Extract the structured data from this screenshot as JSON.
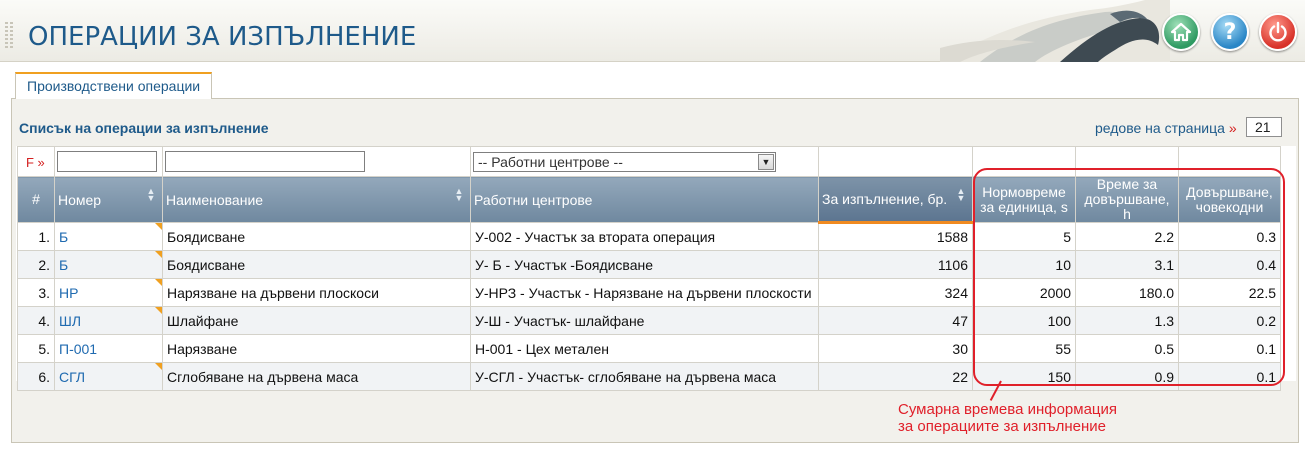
{
  "header": {
    "title": "ОПЕРАЦИИ ЗА ИЗПЪЛНЕНИЕ",
    "buttons": [
      "home-icon",
      "help-icon",
      "power-icon"
    ],
    "help_glyph": "?"
  },
  "tab": {
    "label": "Производствени операции"
  },
  "list": {
    "title": "Списък на операции за изпълнение",
    "rows_per_page_label": "редове на страница",
    "rows_per_page_marker": "»",
    "rows_per_page_value": "21"
  },
  "filter": {
    "label": "F »",
    "work_center_placeholder": "-- Работни центрове --"
  },
  "columns": [
    "#",
    "Номер",
    "Наименование",
    "Работни центрове",
    "За изпълнение, бр.",
    "Нормовреме за единица, s",
    "Време за довършване, h",
    "Довършване, човекодни"
  ],
  "columns_split": {
    "c6a": "Нормовреме",
    "c6b": "за единица, s",
    "c7a": "Време за",
    "c7b": "довършване, h",
    "c8a": "Довършване,",
    "c8b": "човекодни"
  },
  "rows": [
    {
      "idx": "1.",
      "code": "Б",
      "name": "Боядисване",
      "center": "У-002 - Участък за втората операция",
      "qty": "1588",
      "norm": "5",
      "time": "2.2",
      "days": "0.3"
    },
    {
      "idx": "2.",
      "code": "Б",
      "name": "Боядисване",
      "center": "У- Б - Участък -Боядисване",
      "qty": "1106",
      "norm": "10",
      "time": "3.1",
      "days": "0.4"
    },
    {
      "idx": "3.",
      "code": "НР",
      "name": "Нарязване на дървени плоскоси",
      "center": "У-НРЗ - Участък - Нарязване на дървени плоскости",
      "qty": "324",
      "norm": "2000",
      "time": "180.0",
      "days": "22.5"
    },
    {
      "idx": "4.",
      "code": "ШЛ",
      "name": "Шлайфане",
      "center": "У-Ш - Участък- шлайфане",
      "qty": "47",
      "norm": "100",
      "time": "1.3",
      "days": "0.2"
    },
    {
      "idx": "5.",
      "code": "П-001",
      "name": "Нарязване",
      "center": "Н-001 - Цех метален",
      "qty": "30",
      "norm": "55",
      "time": "0.5",
      "days": "0.1"
    },
    {
      "idx": "6.",
      "code": "СГЛ",
      "name": "Сглобяване на дървена маса",
      "center": "У-СГЛ - Участък- сглобяване на дървена маса",
      "qty": "22",
      "norm": "150",
      "time": "0.9",
      "days": "0.1"
    }
  ],
  "annotation": {
    "line1": "Сумарна времева информация",
    "line2": "за операциите за изпълнение"
  },
  "colors": {
    "title_blue": "#1e5a8a",
    "link_blue": "#1f6ab0",
    "accent_orange": "#f0a020",
    "annotation_red": "#e0202a"
  }
}
